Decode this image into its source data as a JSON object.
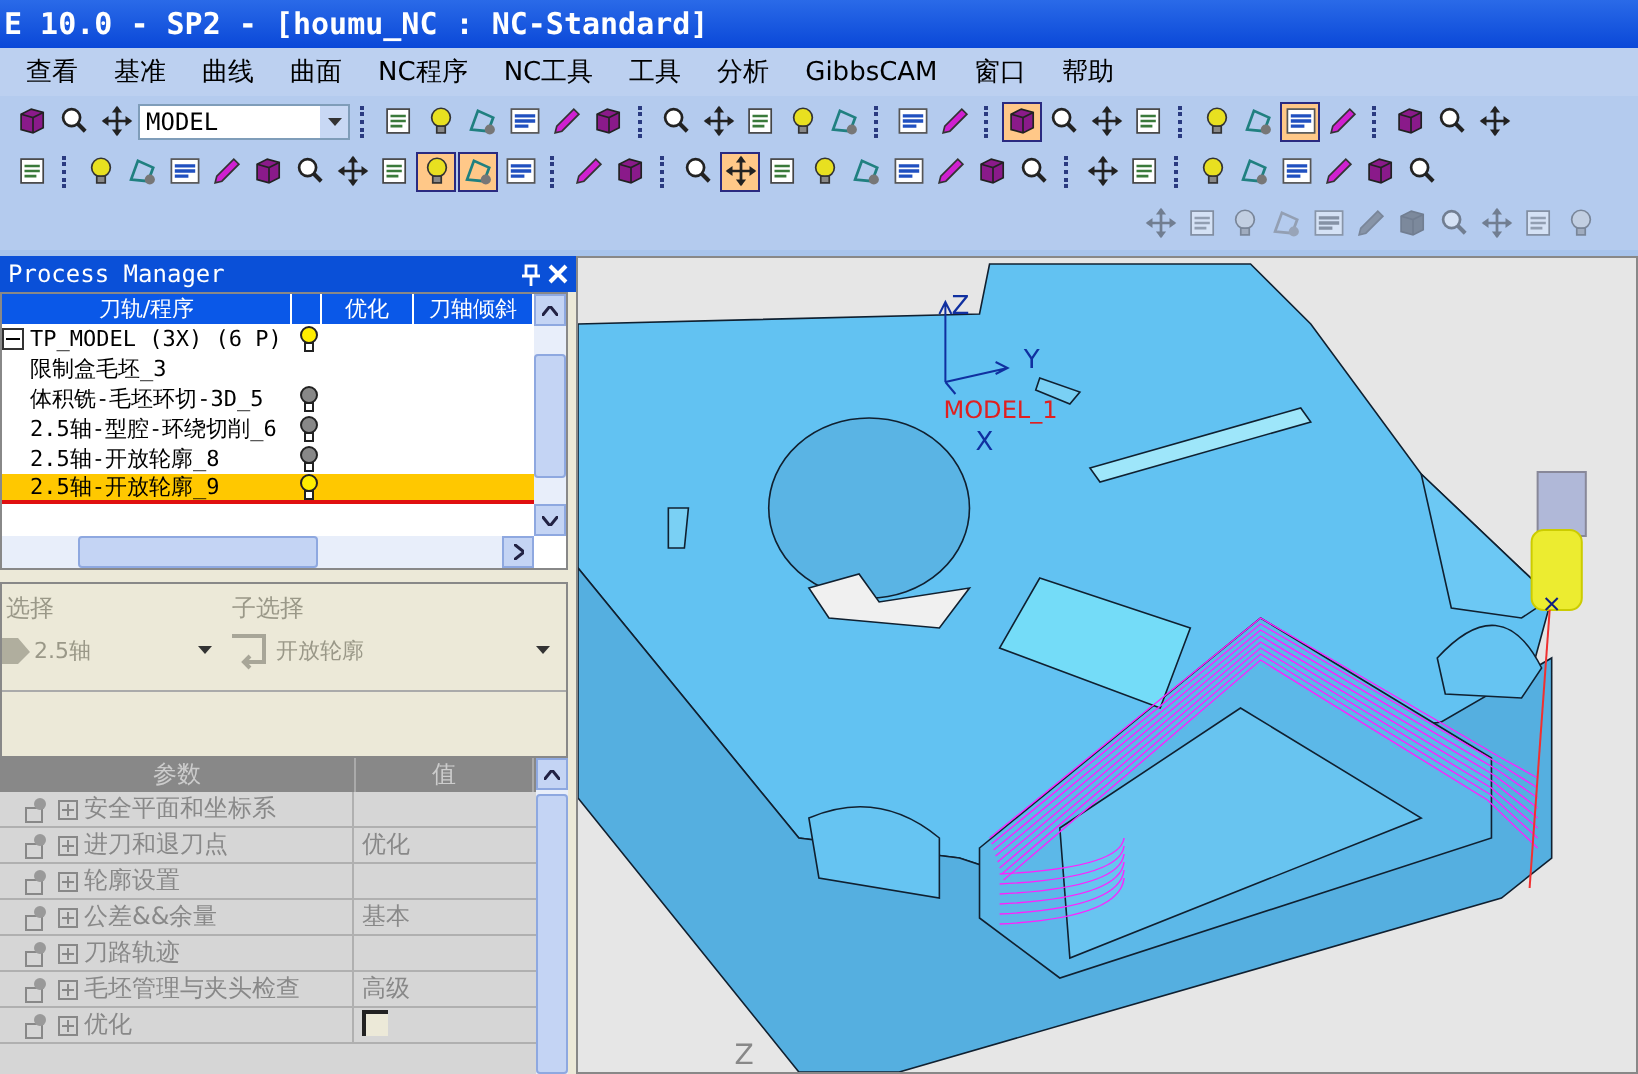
{
  "window": {
    "title": "E 10.0 - SP2 - [houmu_NC : NC-Standard]"
  },
  "menu": [
    "查看",
    "基准",
    "曲线",
    "曲面",
    "NC程序",
    "NC工具",
    "工具",
    "分析",
    "GibbsCAM",
    "窗口",
    "帮助"
  ],
  "toolbars": [
    {
      "disabled": false,
      "items": [
        {
          "kind": "button",
          "pressed": false
        },
        {
          "kind": "button",
          "pressed": false
        },
        {
          "kind": "button",
          "pressed": false
        },
        {
          "kind": "combo",
          "value": "MODEL"
        },
        {
          "kind": "separator"
        },
        {
          "kind": "button",
          "pressed": false
        },
        {
          "kind": "button",
          "pressed": false
        },
        {
          "kind": "button",
          "pressed": false
        },
        {
          "kind": "button",
          "pressed": false
        },
        {
          "kind": "button",
          "pressed": false
        },
        {
          "kind": "button",
          "pressed": false
        },
        {
          "kind": "separator"
        },
        {
          "kind": "button",
          "pressed": false
        },
        {
          "kind": "button",
          "pressed": false
        },
        {
          "kind": "button",
          "pressed": false
        },
        {
          "kind": "button",
          "pressed": false
        },
        {
          "kind": "button",
          "pressed": false
        },
        {
          "kind": "separator"
        },
        {
          "kind": "button",
          "pressed": false
        },
        {
          "kind": "button",
          "pressed": false
        },
        {
          "kind": "separator"
        },
        {
          "kind": "button",
          "pressed": true
        },
        {
          "kind": "button",
          "pressed": false
        },
        {
          "kind": "button",
          "pressed": false
        },
        {
          "kind": "button",
          "pressed": false
        },
        {
          "kind": "separator"
        },
        {
          "kind": "button",
          "pressed": false
        },
        {
          "kind": "button",
          "pressed": false
        },
        {
          "kind": "button",
          "pressed": true
        },
        {
          "kind": "button",
          "pressed": false
        },
        {
          "kind": "separator"
        },
        {
          "kind": "button",
          "pressed": false
        },
        {
          "kind": "button",
          "pressed": false
        },
        {
          "kind": "button",
          "pressed": false
        }
      ]
    },
    {
      "disabled": false,
      "items": [
        {
          "kind": "button",
          "pressed": false
        },
        {
          "kind": "separator"
        },
        {
          "kind": "button",
          "pressed": false
        },
        {
          "kind": "button",
          "pressed": false
        },
        {
          "kind": "button",
          "pressed": false
        },
        {
          "kind": "button",
          "pressed": false
        },
        {
          "kind": "button",
          "pressed": false
        },
        {
          "kind": "button",
          "pressed": false
        },
        {
          "kind": "button",
          "pressed": false
        },
        {
          "kind": "button",
          "pressed": false
        },
        {
          "kind": "button",
          "pressed": true
        },
        {
          "kind": "button",
          "pressed": true
        },
        {
          "kind": "button",
          "pressed": false
        },
        {
          "kind": "separator"
        },
        {
          "kind": "button",
          "pressed": false
        },
        {
          "kind": "button",
          "pressed": false
        },
        {
          "kind": "separator"
        },
        {
          "kind": "button",
          "pressed": false
        },
        {
          "kind": "button",
          "pressed": true
        },
        {
          "kind": "button",
          "pressed": false
        },
        {
          "kind": "button",
          "pressed": false
        },
        {
          "kind": "button",
          "pressed": false
        },
        {
          "kind": "button",
          "pressed": false
        },
        {
          "kind": "button",
          "pressed": false
        },
        {
          "kind": "button",
          "pressed": false
        },
        {
          "kind": "button",
          "pressed": false
        },
        {
          "kind": "separator"
        },
        {
          "kind": "button",
          "pressed": false
        },
        {
          "kind": "button",
          "pressed": false
        },
        {
          "kind": "separator"
        },
        {
          "kind": "button",
          "pressed": false
        },
        {
          "kind": "button",
          "pressed": false
        },
        {
          "kind": "button",
          "pressed": false
        },
        {
          "kind": "button",
          "pressed": false
        },
        {
          "kind": "button",
          "pressed": false
        },
        {
          "kind": "button",
          "pressed": false
        }
      ]
    },
    {
      "disabled": true,
      "items": [
        {
          "kind": "button",
          "pressed": false
        },
        {
          "kind": "button",
          "pressed": false
        },
        {
          "kind": "button",
          "pressed": false
        },
        {
          "kind": "button",
          "pressed": false
        },
        {
          "kind": "button",
          "pressed": false
        },
        {
          "kind": "button",
          "pressed": false
        },
        {
          "kind": "button",
          "pressed": false
        },
        {
          "kind": "button",
          "pressed": false
        },
        {
          "kind": "button",
          "pressed": false
        },
        {
          "kind": "button",
          "pressed": false
        },
        {
          "kind": "button",
          "pressed": false
        }
      ]
    }
  ],
  "process_manager": {
    "title": "Process Manager",
    "columns": [
      "刀轨/程序",
      "优化",
      "刀轴倾斜"
    ],
    "tree": [
      {
        "label": "TP_MODEL (3X) (6 P)",
        "expanded": true,
        "lit": true,
        "selected": false,
        "children": [
          {
            "label": "限制盒毛坯_3",
            "selected": false
          },
          {
            "label": "体积铣-毛坯环切-3D_5",
            "lit": false,
            "selected": false
          },
          {
            "label": "2.5轴-型腔-环绕切削_6",
            "lit": false,
            "selected": false
          },
          {
            "label": "2.5轴-开放轮廓_8",
            "lit": false,
            "selected": false
          },
          {
            "label": "2.5轴-开放轮廓_9",
            "lit": true,
            "selected": true
          }
        ]
      }
    ]
  },
  "selection": {
    "disabled": true,
    "main_label": "选择",
    "main_value": "2.5轴",
    "sub_label": "子选择",
    "sub_value": "开放轮廓"
  },
  "parameters": {
    "columns": [
      "参数",
      "值"
    ],
    "rows": [
      {
        "kind": "group",
        "name": "安全平面和坐标系",
        "expanded": false
      },
      {
        "kind": "group",
        "name": "进刀和退刀点",
        "value": "优化",
        "expanded": false
      },
      {
        "kind": "group",
        "name": "轮廓设置",
        "expanded": false
      },
      {
        "kind": "group",
        "name": "公差&&余量",
        "value": "基本",
        "expanded": false
      },
      {
        "kind": "group",
        "name": "刀路轨迹",
        "expanded": false
      },
      {
        "kind": "group",
        "name": "毛坯管理与夹头检查",
        "value": "高级",
        "expanded": false
      },
      {
        "kind": "checkbox",
        "name": "优化",
        "expanded": false,
        "checked": false
      }
    ]
  },
  "viewport": {
    "axis_z": "Z",
    "axis_y": "Y",
    "model_label": "MODEL_1",
    "axis_x": "X",
    "view_axis": "Z"
  }
}
